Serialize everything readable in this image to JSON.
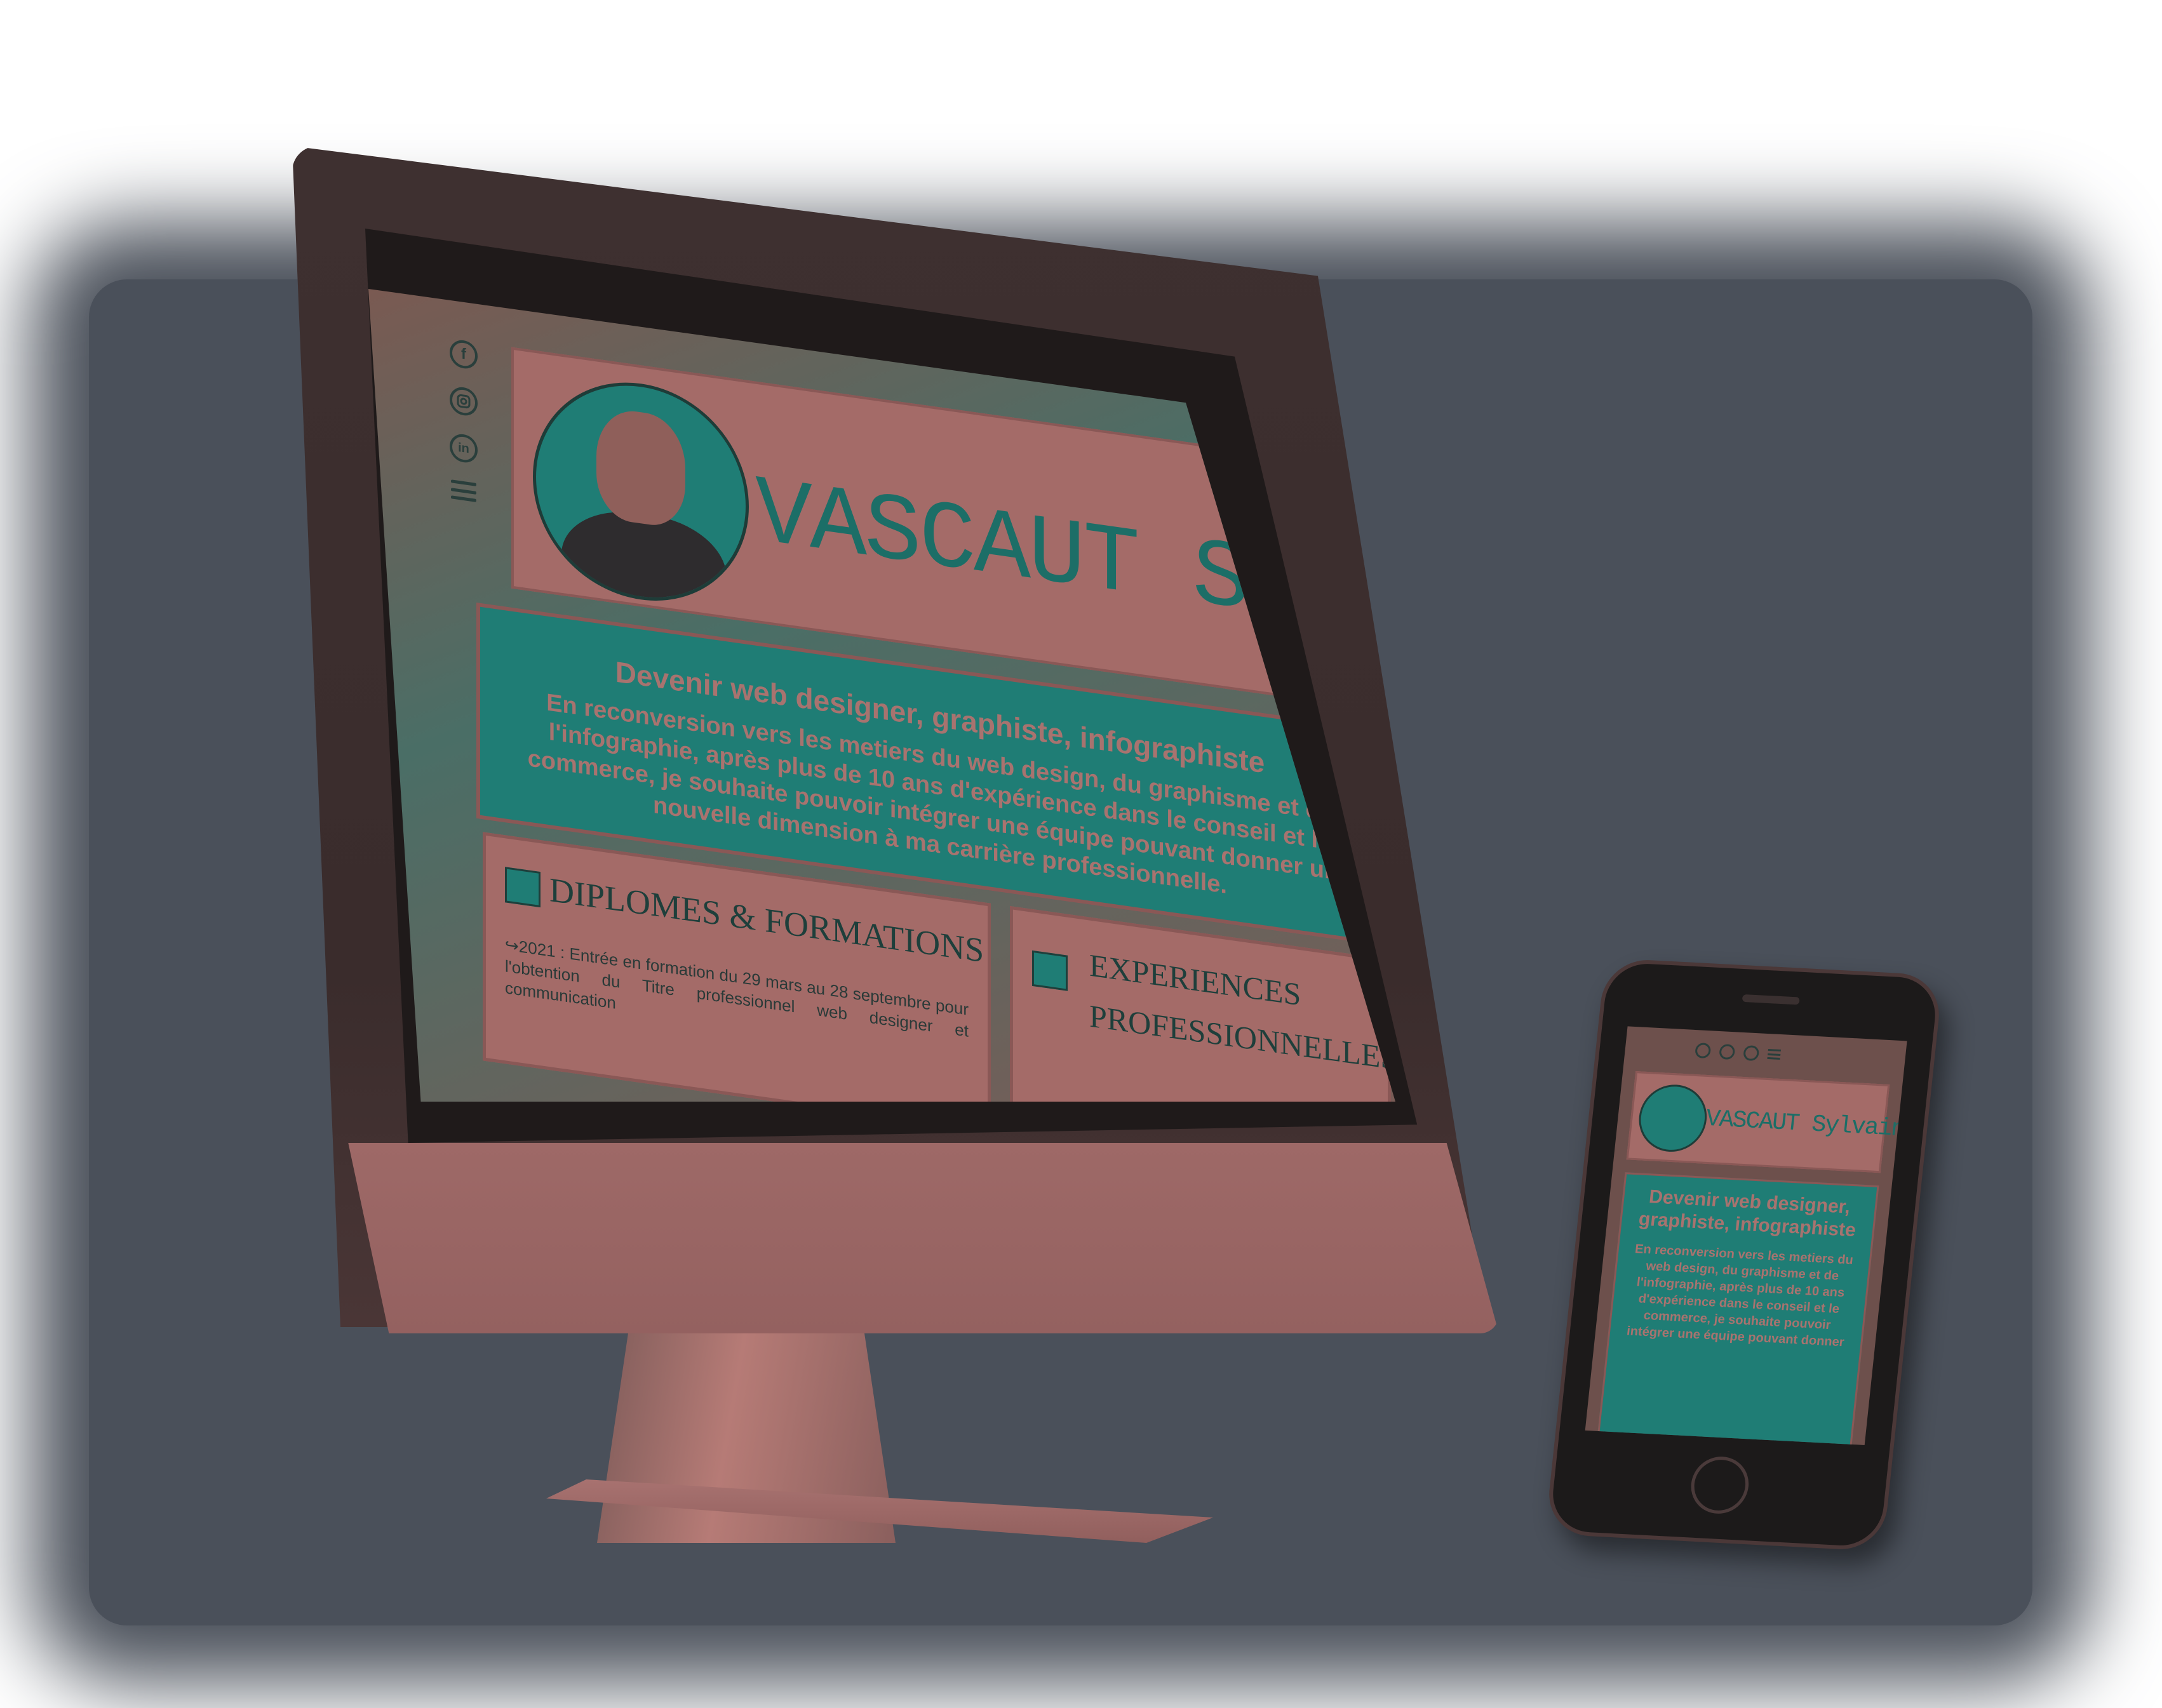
{
  "colors": {
    "backdrop": "#4a505a",
    "accent_teal": "#1f7d75",
    "card_rose": "#a46b68",
    "device_shell": "#9e6967"
  },
  "icons": {
    "facebook": "facebook-icon",
    "instagram": "instagram-icon",
    "linkedin": "linkedin-icon",
    "menu": "hamburger-menu-icon",
    "apple": "apple-logo-icon"
  },
  "site": {
    "social": {
      "facebook": "f",
      "linkedin": "in"
    },
    "name": "VASCAUT Sylvain",
    "hero": {
      "title": "Devenir web designer, graphiste, infographiste",
      "text": "En reconversion vers les metiers du web design, du graphisme et de l'infographie, après plus de 10 ans d'expérience dans le conseil et le commerce, je souhaite pouvoir intégrer une équipe pouvant donner une nouvelle dimension à ma carrière professionnelle."
    },
    "diplomes": {
      "title": "DIPLOMES & FORMATIONS",
      "entry": "↪2021 : Entrée en formation du 29 mars au 28 septembre pour l'obtention du Titre professionnel web designer et communication"
    },
    "experiences": {
      "title": "EXPERIENCES PROFESSIONNELLES"
    }
  },
  "phone": {
    "name": "VASCAUT Sylvain",
    "hero_title": "Devenir web designer, graphiste, infographiste",
    "hero_text": "En reconversion vers les metiers du web design, du graphisme et de l'infographie, après plus de 10 ans d'expérience dans le conseil et le commerce, je souhaite pouvoir intégrer une équipe pouvant donner"
  }
}
